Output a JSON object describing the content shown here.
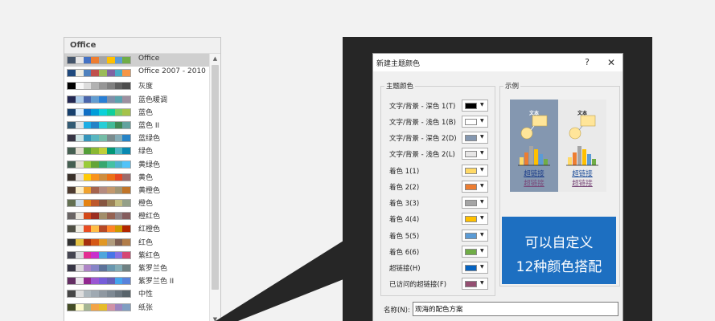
{
  "theme_list": {
    "header": "Office",
    "scroll_up": "▲",
    "scroll_down": "▼",
    "items": [
      {
        "name": "Office",
        "colors": [
          "#44546a",
          "#e7e6e6",
          "#4472c4",
          "#ed7d31",
          "#a5a5a5",
          "#ffc000",
          "#5b9bd5",
          "#70ad47"
        ]
      },
      {
        "name": "Office 2007 - 2010",
        "colors": [
          "#1f497d",
          "#eeece1",
          "#4f81bd",
          "#c0504d",
          "#9bbb59",
          "#8064a2",
          "#4bacc6",
          "#f79646"
        ]
      },
      {
        "name": "灰度",
        "colors": [
          "#000000",
          "#f8f8f8",
          "#dddddd",
          "#b2b2b2",
          "#969696",
          "#808080",
          "#5f5f5f",
          "#4d4d4d"
        ]
      },
      {
        "name": "蓝色暖调",
        "colors": [
          "#242852",
          "#acccea",
          "#4a66ac",
          "#629dd1",
          "#297fd5",
          "#7f8fa9",
          "#5aa2ae",
          "#9d90a0"
        ]
      },
      {
        "name": "蓝色",
        "colors": [
          "#17406d",
          "#dbefff",
          "#0f6fc6",
          "#009dd9",
          "#0bd0d9",
          "#10cf9b",
          "#7cca62",
          "#a5c249"
        ]
      },
      {
        "name": "蓝色 II",
        "colors": [
          "#335b74",
          "#dfe3e5",
          "#1cade4",
          "#2683c6",
          "#27ced7",
          "#42ba97",
          "#3e8853",
          "#62a39f"
        ]
      },
      {
        "name": "蓝绿色",
        "colors": [
          "#373545",
          "#cee6e6",
          "#3494ba",
          "#58b6c0",
          "#75bda7",
          "#7a8c8e",
          "#84acb6",
          "#2683c6"
        ]
      },
      {
        "name": "绿色",
        "colors": [
          "#455f51",
          "#e3ded1",
          "#549e39",
          "#8ab833",
          "#c0cf3a",
          "#029676",
          "#4ab5c4",
          "#0989b1"
        ]
      },
      {
        "name": "黄绿色",
        "colors": [
          "#455f51",
          "#e3ded1",
          "#99cb38",
          "#63a537",
          "#37a76f",
          "#44c1a3",
          "#4eb3cf",
          "#51c3f9"
        ]
      },
      {
        "name": "黄色",
        "colors": [
          "#39302a",
          "#e5dedb",
          "#ffca08",
          "#f8931d",
          "#ce8d3e",
          "#ec7016",
          "#e64823",
          "#9c6a6a"
        ]
      },
      {
        "name": "黄橙色",
        "colors": [
          "#4e3b30",
          "#fbeec9",
          "#f0a22e",
          "#a5644e",
          "#b58b80",
          "#c3986d",
          "#a19574",
          "#c17529"
        ]
      },
      {
        "name": "橙色",
        "colors": [
          "#637052",
          "#ccddea",
          "#e48312",
          "#bd582c",
          "#865640",
          "#9b8357",
          "#c2bc80",
          "#94a088"
        ]
      },
      {
        "name": "橙红色",
        "colors": [
          "#696464",
          "#e9e5dc",
          "#d34817",
          "#9b2d1f",
          "#a28e6a",
          "#956251",
          "#918485",
          "#855d5d"
        ]
      },
      {
        "name": "红橙色",
        "colors": [
          "#505046",
          "#eeece1",
          "#e84c22",
          "#ffbd47",
          "#b64926",
          "#ff8427",
          "#cc9900",
          "#b22600"
        ]
      },
      {
        "name": "红色",
        "colors": [
          "#323232",
          "#e5c243",
          "#a5300f",
          "#d55816",
          "#e19825",
          "#b19c7d",
          "#7f5f52",
          "#b27d49"
        ]
      },
      {
        "name": "紫红色",
        "colors": [
          "#454551",
          "#d8d9dc",
          "#e32d91",
          "#c830cc",
          "#4ea6dc",
          "#4775e7",
          "#8971e1",
          "#d54773"
        ]
      },
      {
        "name": "紫罗兰色",
        "colors": [
          "#373545",
          "#dcd8dc",
          "#ad84c6",
          "#8784c7",
          "#5d739a",
          "#6997af",
          "#84acb6",
          "#6f8183"
        ]
      },
      {
        "name": "紫罗兰色 II",
        "colors": [
          "#632e62",
          "#eae5eb",
          "#92278f",
          "#9b57d3",
          "#755dd9",
          "#665eb8",
          "#45a5ed",
          "#5982db"
        ]
      },
      {
        "name": "中性",
        "colors": [
          "#464646",
          "#dddddd",
          "#aeb8be",
          "#9fa9b2",
          "#8f98a1",
          "#7e8993",
          "#6b767f",
          "#59646b"
        ]
      },
      {
        "name": "纸张",
        "colors": [
          "#444d26",
          "#fefac9",
          "#a5b592",
          "#f3a447",
          "#e7bc29",
          "#d092a7",
          "#9c85c0",
          "#809ec2"
        ]
      }
    ]
  },
  "dialog": {
    "title": "新建主题颜色",
    "help_label": "?",
    "close_label": "✕",
    "theme_colors": {
      "title": "主题颜色",
      "rows": [
        {
          "label": "文字/背景 - 深色 1(T)",
          "color": "#000000"
        },
        {
          "label": "文字/背景 - 浅色 1(B)",
          "color": "#ffffff"
        },
        {
          "label": "文字/背景 - 深色 2(D)",
          "color": "#8497b0"
        },
        {
          "label": "文字/背景 - 浅色 2(L)",
          "color": "#e7e6e6"
        },
        {
          "label": "着色 1(1)",
          "color": "#ffd966"
        },
        {
          "label": "着色 2(2)",
          "color": "#ed7d31"
        },
        {
          "label": "着色 3(3)",
          "color": "#a5a5a5"
        },
        {
          "label": "着色 4(4)",
          "color": "#ffc000"
        },
        {
          "label": "着色 5(5)",
          "color": "#5b9bd5"
        },
        {
          "label": "着色 6(6)",
          "color": "#70ad47"
        },
        {
          "label": "超链接(H)",
          "color": "#0563c1"
        },
        {
          "label": "已访问的超链接(F)",
          "color": "#954f72"
        }
      ]
    },
    "example": {
      "title": "示例",
      "text_label": "文本",
      "hyperlink": "超链接",
      "visited_hyperlink": "超链接"
    },
    "banner": {
      "line1": "可以自定义",
      "line2": "12种颜色搭配",
      "color": "#1d6fc1"
    },
    "name_field": {
      "label": "名称(N):",
      "value": "观海的配色方案"
    }
  }
}
